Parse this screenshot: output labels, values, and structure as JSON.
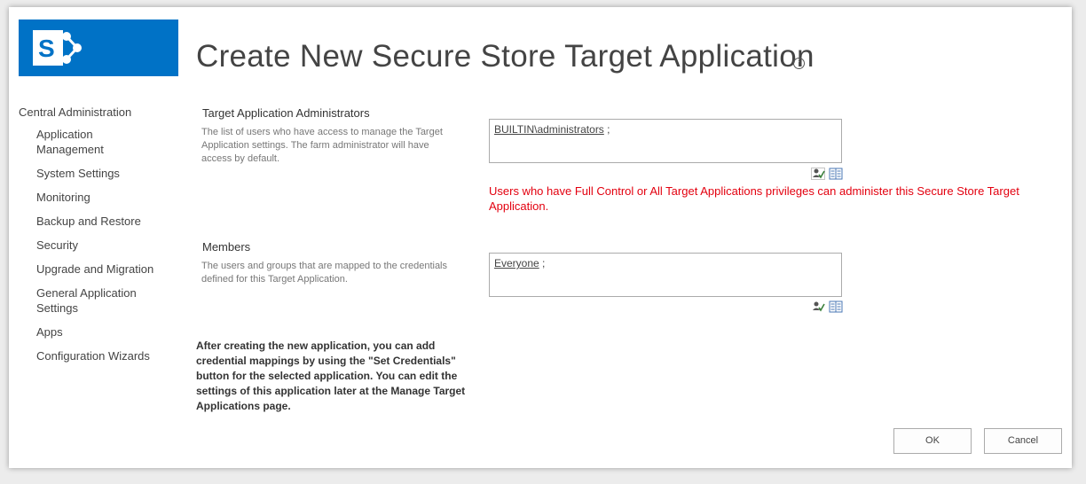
{
  "header": {
    "title": "Create New Secure Store Target Application",
    "brand_color": "#0072c6"
  },
  "nav": {
    "root": "Central Administration",
    "items": [
      {
        "label": "Application Management"
      },
      {
        "label": "System Settings"
      },
      {
        "label": "Monitoring"
      },
      {
        "label": "Backup and Restore"
      },
      {
        "label": "Security"
      },
      {
        "label": "Upgrade and Migration"
      },
      {
        "label": "General Application Settings"
      },
      {
        "label": "Apps"
      },
      {
        "label": "Configuration Wizards"
      }
    ]
  },
  "admins": {
    "title": "Target Application Administrators",
    "description": "The list of users who have access to manage the Target Application settings. The farm administrator will have access by default.",
    "value": "BUILTIN\\administrators",
    "separator": " ;",
    "warning": "Users who have Full Control or All Target Applications privileges can administer this Secure Store Target Application.",
    "warning_color": "#e3000f"
  },
  "members": {
    "title": "Members",
    "description": "The users and groups that are mapped to the credentials defined for this Target Application.",
    "value": "Everyone",
    "separator": " ;"
  },
  "note": "After creating the new application, you can add credential mappings by using the \"Set Credentials\" button for the selected application. You can edit the settings of this application later at the Manage Target Applications page.",
  "buttons": {
    "ok": "OK",
    "cancel": "Cancel"
  }
}
